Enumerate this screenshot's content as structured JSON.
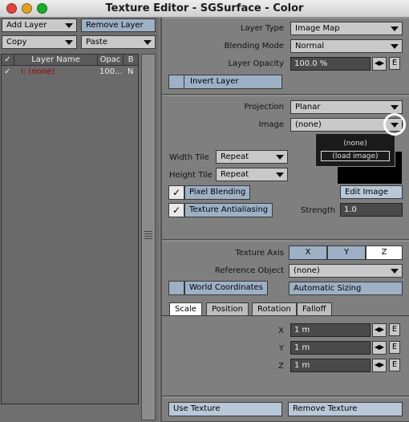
{
  "window": {
    "title": "Texture Editor - SGSurface - Color"
  },
  "colors": {
    "close": "#e0443e",
    "minimize": "#dea123",
    "zoom": "#1aab29",
    "accent": "#9db0c5"
  },
  "left": {
    "add_layer": "Add Layer",
    "remove_layer": "Remove Layer",
    "copy": "Copy",
    "paste": "Paste",
    "table": {
      "headers": {
        "check": "✓",
        "name": "Layer Name",
        "opacity": "Opac",
        "blend": "B"
      },
      "rows": [
        {
          "check": "✓",
          "name": "I: (none)",
          "opacity": "100...",
          "blend": "N"
        }
      ]
    }
  },
  "layer": {
    "type_label": "Layer Type",
    "type_value": "Image Map",
    "blending_label": "Blending Mode",
    "blending_value": "Normal",
    "opacity_label": "Layer Opacity",
    "opacity_value": "100.0 %",
    "invert": "Invert Layer",
    "e_label": "E"
  },
  "projection": {
    "projection_label": "Projection",
    "projection_value": "Planar",
    "image_label": "Image",
    "image_value": "(none)",
    "popup": [
      "(none)",
      "(load image)"
    ],
    "width_tile_label": "Width Tile",
    "width_tile_value": "Repeat",
    "height_tile_label": "Height Tile",
    "height_tile_value": "Repeat",
    "pixel_blending": "Pixel Blending",
    "texture_aa": "Texture Antialiasing",
    "edit_image": "Edit Image",
    "strength_label": "Strength",
    "strength_value": "1.0",
    "checkmark": "✓"
  },
  "axis": {
    "axis_label": "Texture Axis",
    "x": "X",
    "y": "Y",
    "z": "Z",
    "ref_label": "Reference Object",
    "ref_value": "(none)",
    "world_coords": "World Coordinates",
    "auto_sizing": "Automatic Sizing"
  },
  "tabs": [
    "Scale",
    "Position",
    "Rotation",
    "Falloff"
  ],
  "scale": {
    "x_label": "X",
    "x_value": "1 m",
    "y_label": "Y",
    "y_value": "1 m",
    "z_label": "Z",
    "z_value": "1 m"
  },
  "footer": {
    "use_texture": "Use Texture",
    "remove_texture": "Remove Texture"
  }
}
